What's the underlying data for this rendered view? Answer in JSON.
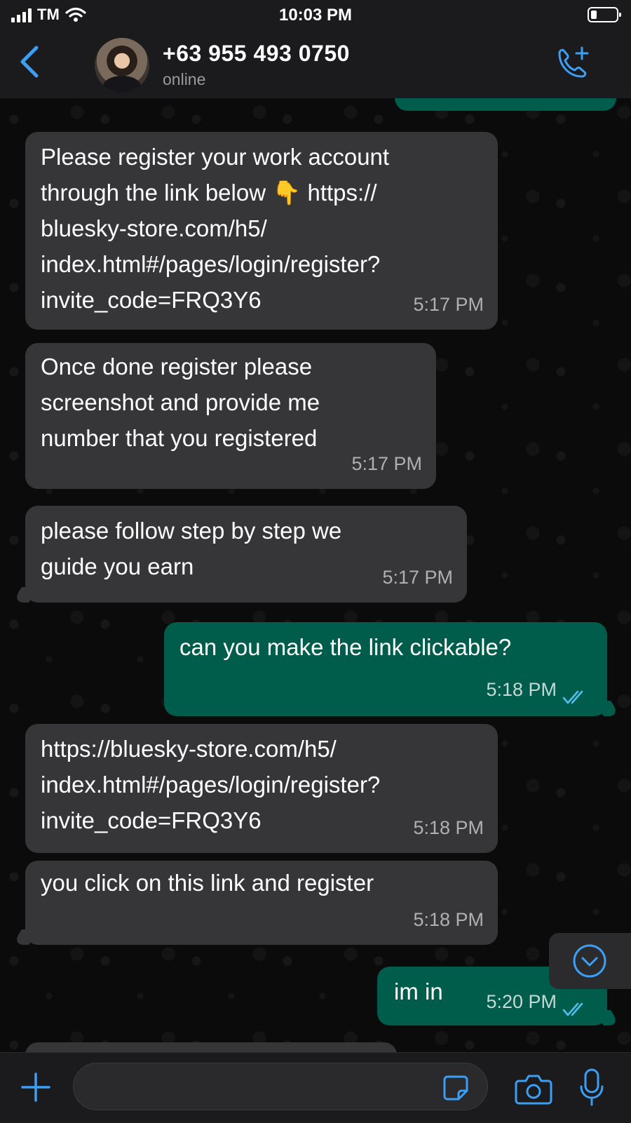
{
  "status_bar": {
    "carrier": "TM",
    "time": "10:03 PM"
  },
  "header": {
    "contact_name": "+63 955 493 0750",
    "contact_status": "online",
    "icons": [
      "back-chevron-icon",
      "avatar",
      "call-add-icon"
    ]
  },
  "messages": [
    {
      "direction": "in",
      "text": "Please register your work account\nthrough the link below 👇 https://\nbluesky-store.com/h5/\nindex.html#/pages/login/register?\ninvite_code=FRQ3Y6",
      "time": "5:17 PM"
    },
    {
      "direction": "in",
      "text": "Once done register please\nscreenshot and provide me\nnumber that you registered",
      "time": "5:17 PM"
    },
    {
      "direction": "in",
      "text": "please follow step by step we\nguide you earn",
      "time": "5:17 PM"
    },
    {
      "direction": "out",
      "text": "can you make the link clickable?",
      "time": "5:18 PM",
      "read": true
    },
    {
      "direction": "in",
      "text": "https://bluesky-store.com/h5/\nindex.html#/pages/login/register?\ninvite_code=FRQ3Y6",
      "time": "5:18 PM"
    },
    {
      "direction": "in",
      "text": "you click on this link and register",
      "time": "5:18 PM"
    },
    {
      "direction": "out",
      "text": "im in",
      "time": "5:20 PM",
      "read": true
    }
  ],
  "input_bar": {
    "placeholder": "",
    "icons": [
      "plus-icon",
      "sticker-icon",
      "camera-icon",
      "microphone-icon"
    ]
  },
  "colors": {
    "incoming_bubble": "#363638",
    "outgoing_bubble": "#005c4b",
    "read_ticks": "#53bdeb",
    "accent": "#3b9ff5"
  }
}
